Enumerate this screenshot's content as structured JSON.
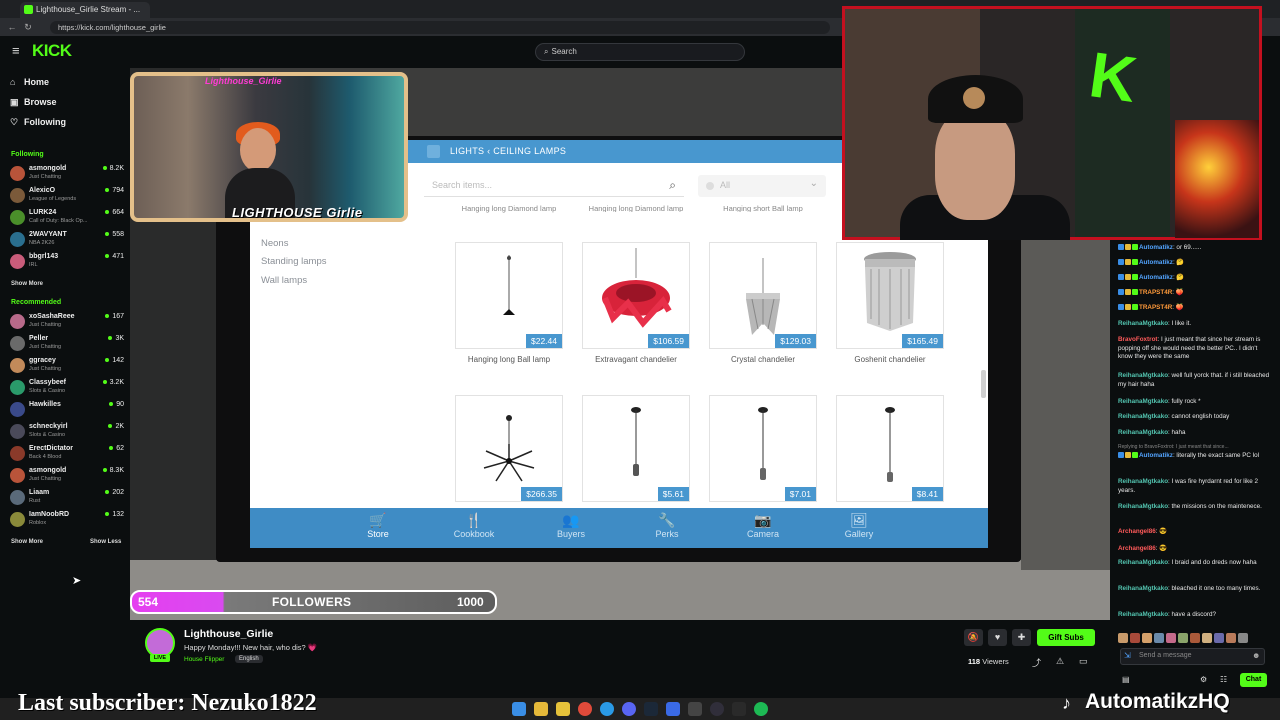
{
  "browser": {
    "tab_title": "Lighthouse_Girlie Stream - ...",
    "url": "https://kick.com/lighthouse_girlie"
  },
  "kick": {
    "logo": "KICK",
    "search_placeholder": "Search",
    "nav": [
      {
        "label": "Home",
        "icon": "home-icon"
      },
      {
        "label": "Browse",
        "icon": "compass-icon"
      },
      {
        "label": "Following",
        "icon": "heart-icon"
      }
    ],
    "following_header": "Following",
    "following": [
      {
        "name": "asmongold",
        "category": "Just Chatting",
        "viewers": "8.2K",
        "color": "#b9543a"
      },
      {
        "name": "AlexicO",
        "category": "League of Legends",
        "viewers": "794",
        "color": "#7b5a3a"
      },
      {
        "name": "LURK24",
        "category": "Call of Duty: Black Op...",
        "viewers": "664",
        "color": "#4a8f2a"
      },
      {
        "name": "2WAVYANT",
        "category": "NBA 2K26",
        "viewers": "558",
        "color": "#2a6f8f"
      },
      {
        "name": "bbgrl143",
        "category": "IRL",
        "viewers": "471",
        "color": "#c95c7a"
      }
    ],
    "show_more_1": "Show More",
    "recommended_header": "Recommended",
    "recommended": [
      {
        "name": "xoSashaReee",
        "category": "Just Chatting",
        "viewers": "167",
        "color": "#b86a8a"
      },
      {
        "name": "Peller",
        "category": "Just Chatting",
        "viewers": "3K",
        "color": "#6a6a6a"
      },
      {
        "name": "ggracey",
        "category": "Just Chatting",
        "viewers": "142",
        "color": "#c28a5a"
      },
      {
        "name": "Classybeef",
        "category": "Slots & Casino",
        "viewers": "3.2K",
        "color": "#2a9a6a"
      },
      {
        "name": "Hawkilles",
        "category": "",
        "viewers": "90",
        "color": "#3a4a8a"
      },
      {
        "name": "schneckyirl",
        "category": "Slots & Casino",
        "viewers": "2K",
        "color": "#4a4a5a"
      },
      {
        "name": "ErectDictator",
        "category": "Back 4 Blood",
        "viewers": "62",
        "color": "#8a3a2a"
      },
      {
        "name": "asmongold",
        "category": "Just Chatting",
        "viewers": "8.3K",
        "color": "#b9543a"
      },
      {
        "name": "Liaam",
        "category": "Rust",
        "viewers": "202",
        "color": "#5a6a7a"
      },
      {
        "name": "IamNoobRD",
        "category": "Roblox",
        "viewers": "132",
        "color": "#8a8a3a"
      }
    ],
    "show_more_2": "Show More",
    "show_less": "Show Less"
  },
  "game": {
    "breadcrumb_root": "LIGHTS",
    "breadcrumb_sep": "‹",
    "breadcrumb_leaf": "CEILING LAMPS",
    "search_placeholder": "Search items...",
    "filter_value": "All",
    "categories": [
      "Neons",
      "Standing lamps",
      "Wall lamps"
    ],
    "cut_labels": [
      "Hanging long Diamond lamp",
      "Hanging long Diamond lamp",
      "Hanging short Ball lamp"
    ],
    "items_row1": [
      {
        "name": "Hanging long Ball lamp",
        "price": "$22.44"
      },
      {
        "name": "Extravagant chandelier",
        "price": "$106.59"
      },
      {
        "name": "Crystal chandelier",
        "price": "$129.03"
      },
      {
        "name": "Goshenit chandelier",
        "price": "$165.49"
      }
    ],
    "items_row2": [
      {
        "price": "$266.35"
      },
      {
        "price": "$5.61"
      },
      {
        "price": "$7.01"
      },
      {
        "price": "$8.41"
      }
    ],
    "tabs": [
      {
        "label": "Store",
        "icon": "cart-icon"
      },
      {
        "label": "Cookbook",
        "icon": "utensils-icon"
      },
      {
        "label": "Buyers",
        "icon": "people-icon"
      },
      {
        "label": "Perks",
        "icon": "wrench-icon"
      },
      {
        "label": "Camera",
        "icon": "camera-icon"
      },
      {
        "label": "Gallery",
        "icon": "image-icon"
      }
    ]
  },
  "overlay": {
    "cam1_title": "Lighthouse_Girlie",
    "cam1_logo": "LIGHTHOUSE Girlie",
    "followers_current": "554",
    "followers_label": "FOLLOWERS",
    "followers_goal": "1000",
    "followers_progress": 0.554,
    "last_subscriber": "Last subscriber: Nezuko1822",
    "brand": "AutomatikzHQ"
  },
  "stream": {
    "name": "Lighthouse_Girlie",
    "title": "Happy Monday!!! New hair, who dis? 💗",
    "category": "House Flipper",
    "language": "English",
    "live": "LIVE",
    "gift_label": "Gift Subs",
    "viewers_count": "118",
    "viewers_label": "Viewers"
  },
  "chat": {
    "messages": [
      {
        "user": "Automatikz",
        "text": ": or 69......",
        "color": "#53a4ff"
      },
      {
        "user": "Automatikz",
        "text": ": 🤔",
        "color": "#53a4ff"
      },
      {
        "user": "Automatikz",
        "text": ": 🤔",
        "color": "#53a4ff"
      },
      {
        "user": "TRAPST4R",
        "text": ": 🍑",
        "color": "#ff9a3a"
      },
      {
        "user": "TRAPST4R",
        "text": ": 🍑",
        "color": "#ff9a3a"
      },
      {
        "user": "ReihanaMgtkako",
        "text": ": I like it.",
        "color": "#53c4b0"
      },
      {
        "user": "BravoFoxtrot",
        "text": ": I just meant that since her stream is popping off she would need the better PC.. I didn't know they were the same",
        "color": "#ff5a5a"
      },
      {
        "user": "ReihanaMgtkako",
        "text": ": well full yorck that. if i still bleached my hair haha",
        "color": "#53c4b0"
      },
      {
        "user": "ReihanaMgtkako",
        "text": ": fully rock *",
        "color": "#53c4b0"
      },
      {
        "user": "ReihanaMgtkako",
        "text": ": cannot english today",
        "color": "#53c4b0"
      },
      {
        "user": "ReihanaMgtkako",
        "text": ": haha",
        "color": "#53c4b0"
      },
      {
        "user": "Automatikz",
        "text": ": literally the exact same PC lol",
        "color": "#53a4ff"
      },
      {
        "user": "ReihanaMgtkako",
        "text": ": I was fire hyrdarnt red for like 2 years.",
        "color": "#53c4b0"
      },
      {
        "user": "ReihanaMgtkako",
        "text": ": the missions on the maintenece.",
        "color": "#53c4b0"
      },
      {
        "user": "Archangel86",
        "text": ": 😎",
        "color": "#ff5a5a"
      },
      {
        "user": "Archangel86",
        "text": ": 😎",
        "color": "#ff5a5a"
      },
      {
        "user": "ReihanaMgtkako",
        "text": ": I braid and do dreds now haha",
        "color": "#53c4b0"
      },
      {
        "user": "ReihanaMgtkako",
        "text": ": bleached it one too many times.",
        "color": "#53c4b0"
      },
      {
        "user": "ReihanaMgtkako",
        "text": ": have a discord?",
        "color": "#53c4b0"
      }
    ],
    "reply_note": "Replying to BravoFoxtrot: I just meant that since...",
    "input_placeholder": "Send a message",
    "chat_button": "Chat"
  },
  "colors": {
    "kick_green": "#53fc18",
    "game_blue": "#4897cf",
    "follower_pink": "#e53ff0"
  }
}
